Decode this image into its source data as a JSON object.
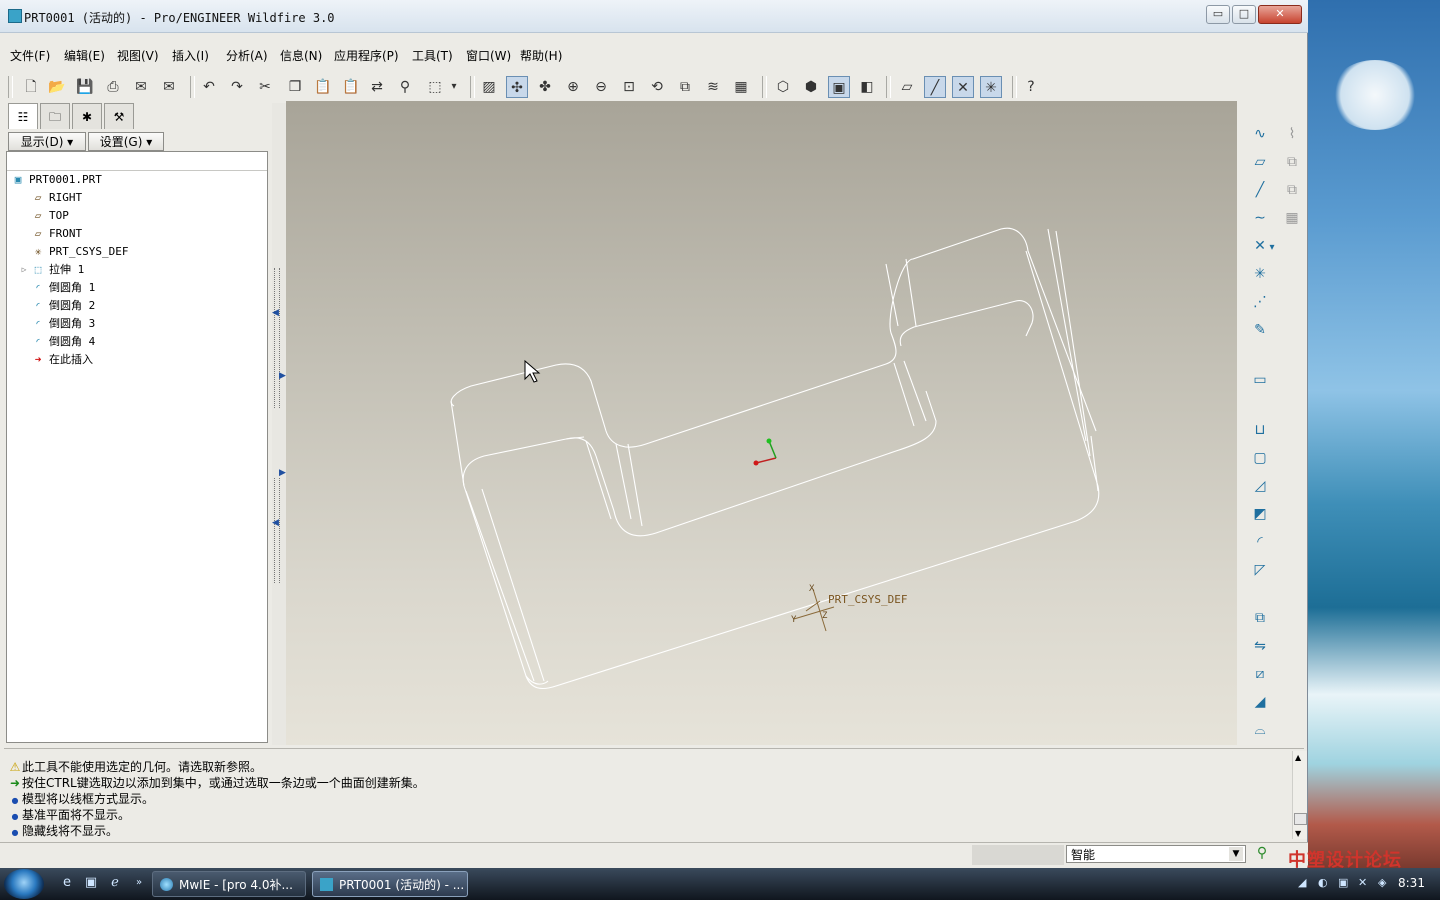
{
  "window": {
    "title": "PRT0001 (活动的) - Pro/ENGINEER Wildfire 3.0",
    "min": "▭",
    "max": "□",
    "close": "✕"
  },
  "menu": [
    "文件(F)",
    "编辑(E)",
    "视图(V)",
    "插入(I)",
    "分析(A)",
    "信息(N)",
    "应用程序(P)",
    "工具(T)",
    "窗口(W)",
    "帮助(H)"
  ],
  "toolbar_icons": [
    "new-file-icon",
    "open-icon",
    "save-icon",
    "print-icon",
    "email-icon",
    "email-link-icon",
    "undo-icon",
    "redo-icon",
    "cut-icon",
    "copy-icon",
    "paste-icon",
    "paste-special-icon",
    "regenerate-icon",
    "find-icon",
    "select-box-icon",
    "dropdown-icon",
    "repaint-icon",
    "spin-center-icon",
    "orient-mode-icon",
    "zoom-in-icon",
    "zoom-out-icon",
    "refit-icon",
    "reorient-icon",
    "saved-views-icon",
    "layers-icon",
    "view-manager-icon",
    "wireframe-icon",
    "hidden-line-icon",
    "no-hidden-icon",
    "shaded-icon",
    "datum-planes-icon",
    "datum-axes-icon",
    "datum-points-icon",
    "coord-sys-icon",
    "whats-this-icon"
  ],
  "left_panel": {
    "show_button": "显示(D) ▾",
    "settings_button": "设置(G) ▾",
    "tree": [
      {
        "label": "PRT0001.PRT",
        "icon": "part-icon",
        "indent": 0
      },
      {
        "label": "RIGHT",
        "icon": "datum-plane-icon",
        "indent": 1
      },
      {
        "label": "TOP",
        "icon": "datum-plane-icon",
        "indent": 1
      },
      {
        "label": "FRONT",
        "icon": "datum-plane-icon",
        "indent": 1
      },
      {
        "label": "PRT_CSYS_DEF",
        "icon": "csys-icon",
        "indent": 1
      },
      {
        "label": "拉伸 1",
        "icon": "extrude-icon",
        "indent": 1
      },
      {
        "label": "倒圆角 1",
        "icon": "round-icon",
        "indent": 1
      },
      {
        "label": "倒圆角 2",
        "icon": "round-icon",
        "indent": 1
      },
      {
        "label": "倒圆角 3",
        "icon": "round-icon",
        "indent": 1
      },
      {
        "label": "倒圆角 4",
        "icon": "round-icon",
        "indent": 1
      },
      {
        "label": "在此插入",
        "icon": "insert-here-icon",
        "indent": 1
      }
    ]
  },
  "graphics": {
    "csys_label": "PRT_CSYS_DEF",
    "csys_axis_x": "X",
    "csys_axis_y": "Y",
    "csys_axis_z": "Z"
  },
  "messages": [
    {
      "icon": "warning-icon",
      "glyph": "⚠",
      "color": "#c8a000",
      "text": "此工具不能使用选定的几何。请选取新参照。"
    },
    {
      "icon": "prompt-arrow-icon",
      "glyph": "➜",
      "color": "#1a8a1a",
      "text": "按住CTRL键选取边以添加到集中，或通过选取一条边或一个曲面创建新集。"
    },
    {
      "icon": "info-dot-icon",
      "glyph": "●",
      "color": "#1a4db0",
      "text": "模型将以线框方式显示。"
    },
    {
      "icon": "info-dot-icon",
      "glyph": "●",
      "color": "#1a4db0",
      "text": "基准平面将不显示。"
    },
    {
      "icon": "info-dot-icon",
      "glyph": "●",
      "color": "#1a4db0",
      "text": "隐藏线将不显示。"
    }
  ],
  "status": {
    "filter_value": "智能"
  },
  "taskbar": {
    "tasks": [
      {
        "label": "MwIE - [pro 4.0补...",
        "active": false
      },
      {
        "label": "PRT0001 (活动的) - ...",
        "active": true
      }
    ],
    "clock": "8:31",
    "watermark": "中塑设计论坛"
  }
}
